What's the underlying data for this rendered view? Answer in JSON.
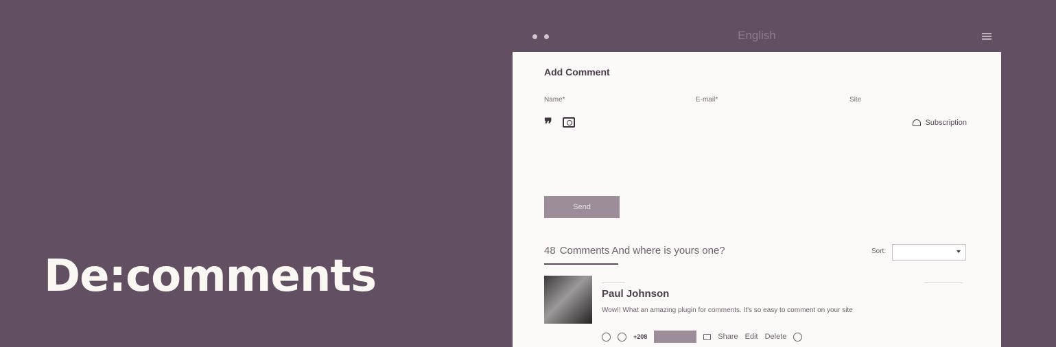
{
  "brand": {
    "title": "De:comments"
  },
  "window": {
    "language": "English"
  },
  "form": {
    "title": "Add Comment",
    "name_label": "Name*",
    "email_label": "E-mail*",
    "site_label": "Site",
    "subscription_label": "Subscription",
    "send_label": "Send"
  },
  "comments": {
    "count": "48",
    "heading": "Comments  And where is yours one?",
    "sort_label": "Sort:",
    "items": [
      {
        "author": "Paul Johnson",
        "text": "Wow!! What an amazing plugin for comments. It's so easy to comment on your site",
        "votes": "+208",
        "share_label": "Share",
        "edit_label": "Edit",
        "delete_label": "Delete"
      }
    ]
  },
  "colors": {
    "background": "#624f61",
    "panel": "#fbfaf8",
    "accent": "#9c8d99"
  }
}
